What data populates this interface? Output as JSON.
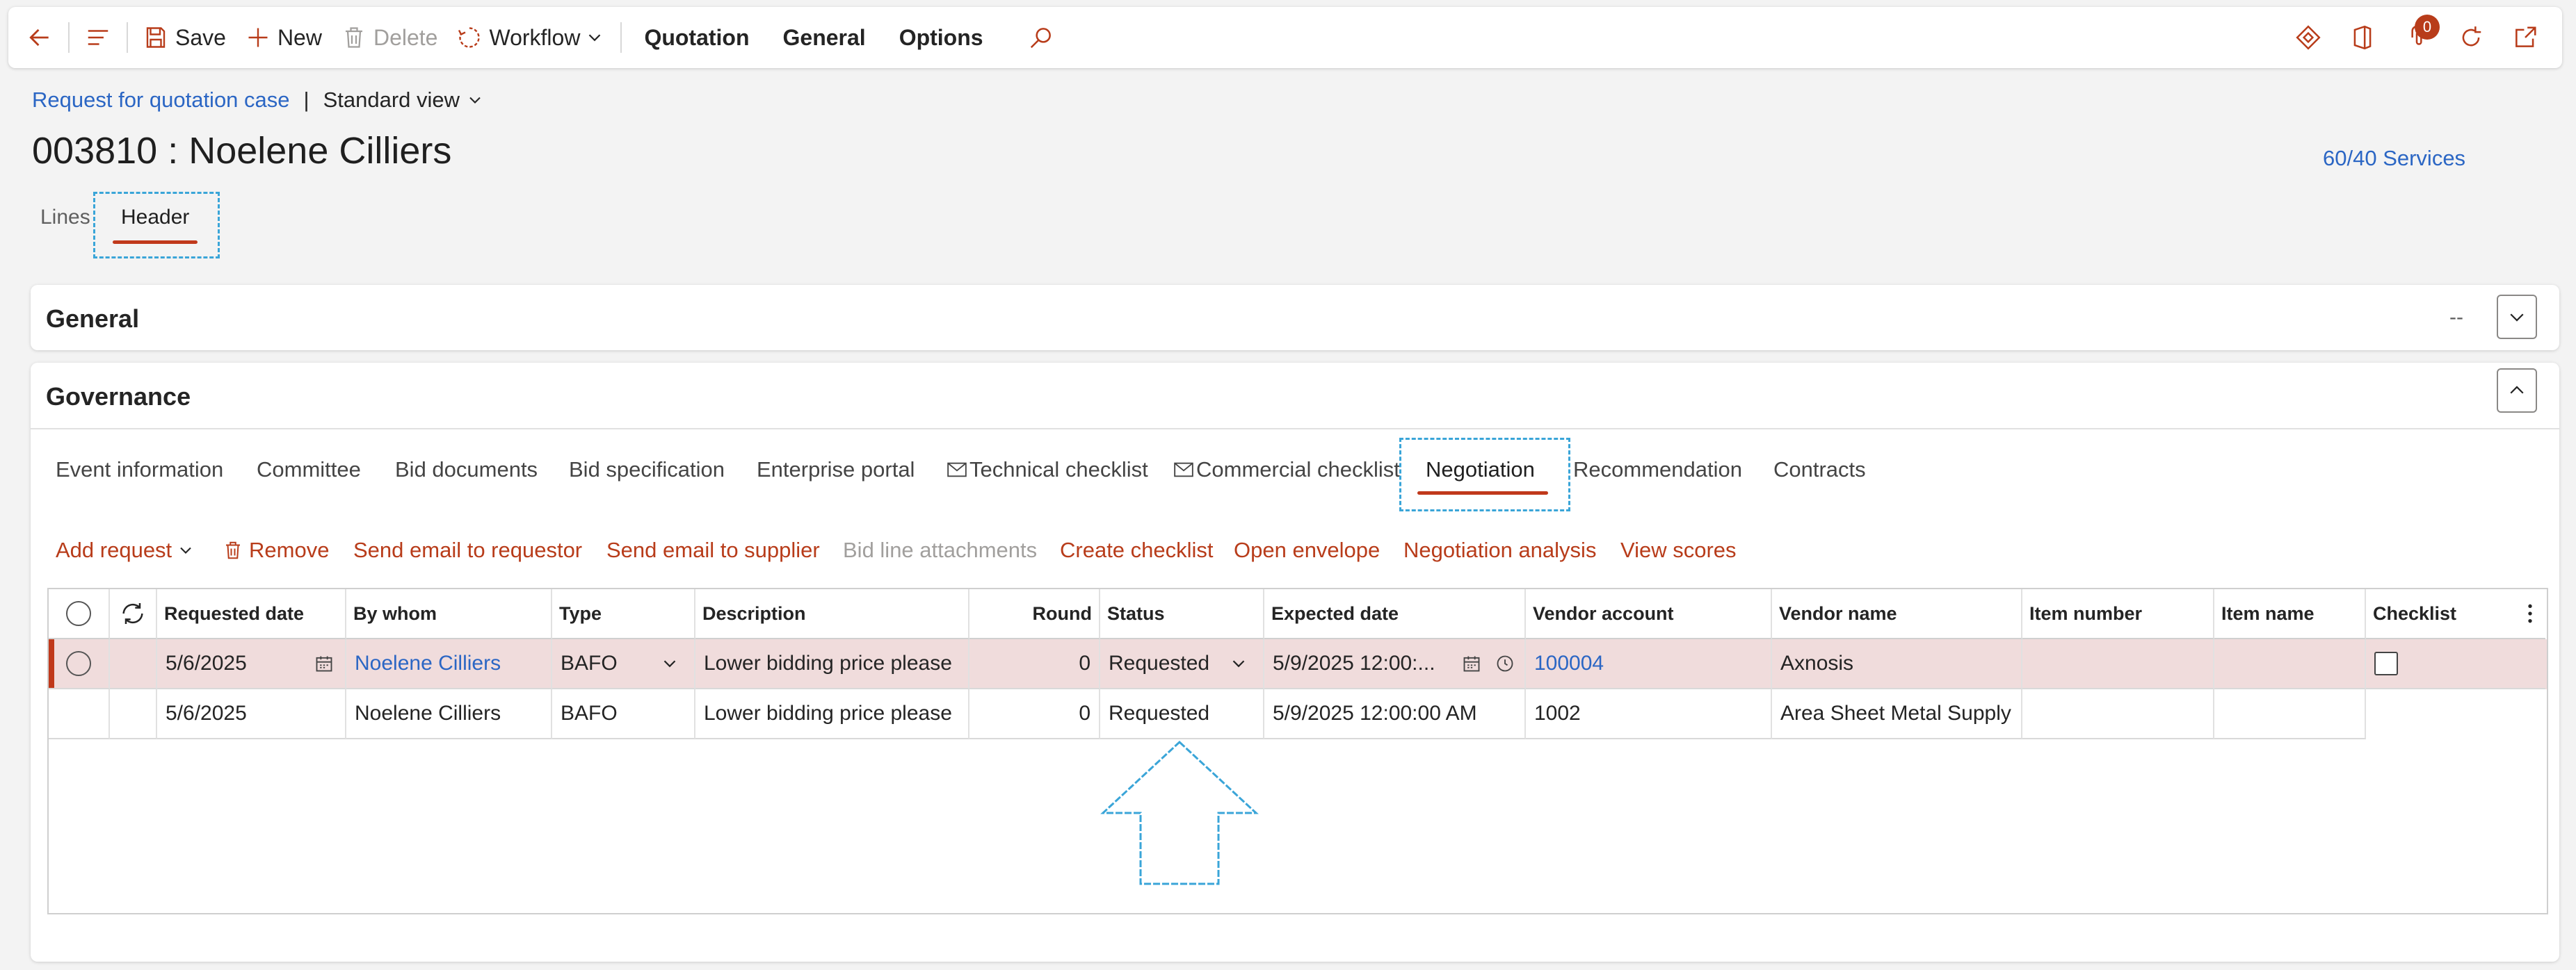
{
  "toolbar": {
    "save": "Save",
    "new": "New",
    "delete": "Delete",
    "workflow": "Workflow",
    "quotation": "Quotation",
    "general": "General",
    "options": "Options",
    "attachments_count": "0"
  },
  "breadcrumb": {
    "link": "Request for quotation case",
    "separator": "|",
    "view": "Standard view"
  },
  "page": {
    "title": "003810 : Noelene Cilliers",
    "services_link": "60/40 Services"
  },
  "page_tabs": [
    "Lines",
    "Header"
  ],
  "sections": {
    "general": {
      "title": "General",
      "summary": "--"
    },
    "governance": {
      "title": "Governance"
    }
  },
  "governance_tabs": [
    "Event information",
    "Committee",
    "Bid documents",
    "Bid specification",
    "Enterprise portal",
    "Technical checklist",
    "Commercial checklist",
    "Negotiation",
    "Recommendation",
    "Contracts"
  ],
  "governance_toolbar": {
    "add_request": "Add request",
    "remove": "Remove",
    "send_email_requestor": "Send email to requestor",
    "send_email_supplier": "Send email to supplier",
    "bid_line_attachments": "Bid line attachments",
    "create_checklist": "Create checklist",
    "open_envelope": "Open envelope",
    "negotiation_analysis": "Negotiation analysis",
    "view_scores": "View scores"
  },
  "grid": {
    "columns": [
      "Requested date",
      "By whom",
      "Type",
      "Description",
      "Round",
      "Status",
      "Expected date",
      "Vendor account",
      "Vendor name",
      "Item number",
      "Item name",
      "Checklist"
    ],
    "rows": [
      {
        "requested_date": "5/6/2025",
        "by_whom": "Noelene Cilliers",
        "type": "BAFO",
        "description": "Lower bidding price please",
        "round": "0",
        "status": "Requested",
        "expected_date": "5/9/2025 12:00:...",
        "vendor_account": "100004",
        "vendor_name": "Axnosis",
        "item_number": "",
        "item_name": ""
      },
      {
        "requested_date": "5/6/2025",
        "by_whom": "Noelene Cilliers",
        "type": "BAFO",
        "description": "Lower bidding price please",
        "round": "0",
        "status": "Requested",
        "expected_date": "5/9/2025 12:00:00 AM",
        "vendor_account": "1002",
        "vendor_name": "Area Sheet Metal Supply",
        "item_number": "",
        "item_name": ""
      }
    ]
  },
  "colors": {
    "accent": "#c0391b",
    "link": "#2b66c4",
    "selected_row": "#f0dcdc",
    "annotation": "#3aa5d8"
  }
}
